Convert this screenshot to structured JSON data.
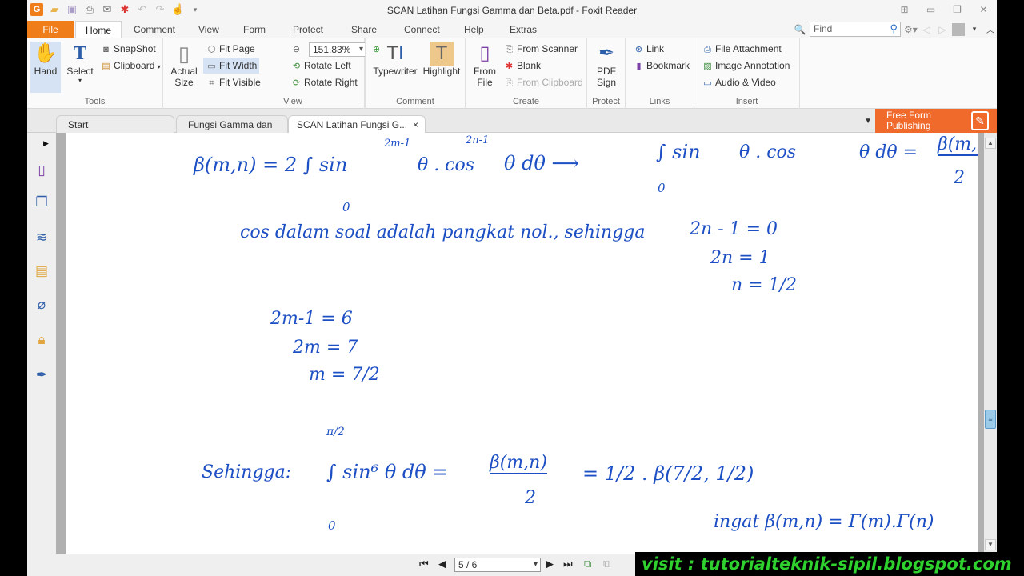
{
  "window": {
    "title": "SCAN Latihan Fungsi Gamma dan Beta.pdf - Foxit Reader",
    "quick_access": [
      "app-logo",
      "open-folder-icon",
      "save-icon",
      "print-icon",
      "email-icon",
      "new-doc-icon",
      "undo-icon",
      "redo-icon",
      "hand-tool-icon",
      "customize-icon"
    ],
    "controls": [
      "restore-layout",
      "minimize",
      "maximize",
      "close"
    ]
  },
  "menu": {
    "tabs": [
      "File",
      "Home",
      "Comment",
      "View",
      "Form",
      "Protect",
      "Share",
      "Connect",
      "Help",
      "Extras"
    ],
    "active": "Home",
    "find_placeholder": "Find"
  },
  "ribbon": {
    "tools": {
      "label": "Tools",
      "hand": "Hand",
      "select": "Select",
      "snapshot": "SnapShot",
      "clipboard": "Clipboard"
    },
    "view": {
      "label": "View",
      "actual_size": "Actual Size",
      "actual_1": "Actual",
      "actual_2": "Size",
      "fit_page": "Fit Page",
      "fit_width": "Fit Width",
      "fit_visible": "Fit Visible",
      "zoom_value": "151.83%",
      "rotate_left": "Rotate Left",
      "rotate_right": "Rotate Right"
    },
    "comment": {
      "label": "Comment",
      "typewriter": "Typewriter",
      "highlight": "Highlight"
    },
    "create": {
      "label": "Create",
      "from_file_1": "From",
      "from_file_2": "File",
      "from_scanner": "From Scanner",
      "blank": "Blank",
      "from_clipboard": "From Clipboard"
    },
    "protect": {
      "label": "Protect",
      "pdf_sign_1": "PDF",
      "pdf_sign_2": "Sign"
    },
    "links": {
      "label": "Links",
      "link": "Link",
      "bookmark": "Bookmark"
    },
    "insert": {
      "label": "Insert",
      "file_attachment": "File Attachment",
      "image_annotation": "Image Annotation",
      "audio_video": "Audio & Video"
    }
  },
  "doc_tabs": [
    {
      "label": "Start",
      "active": false
    },
    {
      "label": "Fungsi Gamma dan BE...",
      "active": false
    },
    {
      "label": "SCAN Latihan Fungsi G...",
      "active": true,
      "close": "×"
    }
  ],
  "promo": {
    "line1": "Free Form",
    "line2": "Publishing"
  },
  "side_panel": [
    "page-thumbnail-icon",
    "pages-icon",
    "layers-icon",
    "comments-icon",
    "attachments-icon",
    "security-icon",
    "signatures-icon"
  ],
  "document": {
    "lines": {
      "l1": "β(m,n) = 2 ∫ sin",
      "l1_exp1": "2m-1",
      "l1_b": "θ . cos",
      "l1_exp2": "2n-1",
      "l1_c": "θ dθ  ⟶",
      "l1_lower": "0",
      "l1_d": "∫ sin",
      "l1_e": "θ . cos",
      "l1_f": "θ dθ = ",
      "l1_frac_num": "β(m,n)",
      "l1_frac_den": "2",
      "l1_lower2": "0",
      "l2": "cos dalam soal adalah pangkat nol., sehingga",
      "n1": "2n - 1 = 0",
      "n2": "2n = 1",
      "n3": "n = 1/2",
      "m1": "2m-1 = 6",
      "m2": "2m = 7",
      "m3": "m = 7/2",
      "s_label": "Sehingga:",
      "s_upper": "π/2",
      "s_integral": "∫ sin⁶ θ dθ = ",
      "s_frac_num": "β(m,n)",
      "s_frac_den": "2",
      "s_rest": "= 1/2 . β(7/2, 1/2)",
      "s_lower": "0",
      "ingat": "ingat β(m,n) = Γ(m).Γ(n)"
    }
  },
  "status": {
    "page": "5 / 6",
    "nav": [
      "first-page",
      "prev-page",
      "next-page",
      "last-page"
    ]
  },
  "watermark": "visit : tutorialteknik-sipil.blogspot.com"
}
